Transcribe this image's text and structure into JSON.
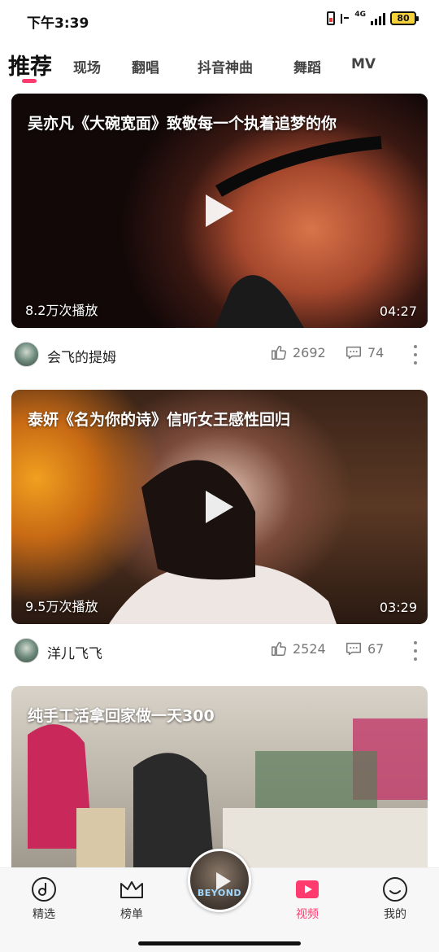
{
  "status_bar": {
    "time": "下午3:39",
    "network": "4G",
    "battery": "80"
  },
  "tabs": [
    {
      "label": "推荐",
      "active": true
    },
    {
      "label": "现场",
      "active": false
    },
    {
      "label": "翻唱",
      "active": false
    },
    {
      "label": "抖音神曲",
      "active": false
    },
    {
      "label": "舞蹈",
      "active": false
    },
    {
      "label": "MV",
      "active": false
    }
  ],
  "videos": [
    {
      "title": "吴亦凡《大碗宽面》致敬每一个执着追梦的你",
      "plays": "8.2万次播放",
      "duration": "04:27",
      "author": "会飞的提姆",
      "likes": "2692",
      "comments": "74"
    },
    {
      "title": "泰妍《名为你的诗》信听女王感性回归",
      "plays": "9.5万次播放",
      "duration": "03:29",
      "author": "洋儿飞飞",
      "likes": "2524",
      "comments": "67"
    },
    {
      "title": "纯手工活拿回家做一天300"
    }
  ],
  "bottom_nav": {
    "items": [
      {
        "label": "精选",
        "icon": "music-disc-icon"
      },
      {
        "label": "榜单",
        "icon": "crown-icon"
      },
      {
        "label": "视频",
        "icon": "video-play-icon",
        "active": true
      },
      {
        "label": "我的",
        "icon": "smile-face-icon"
      }
    ],
    "now_playing_text": "BEYOND"
  },
  "colors": {
    "accent": "#ff3a6e",
    "text": "#222222",
    "muted": "#777777"
  }
}
